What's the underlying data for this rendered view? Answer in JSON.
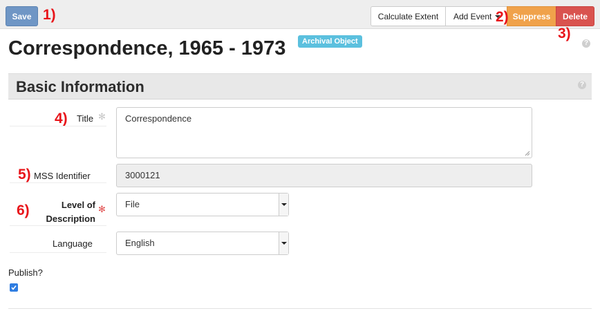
{
  "toolbar": {
    "save_label": "Save",
    "calculate_extent_label": "Calculate Extent",
    "add_event_label": "Add Event",
    "suppress_label": "Suppress",
    "delete_label": "Delete"
  },
  "annotations": [
    "1)",
    "2)",
    "3)",
    "4)",
    "5)",
    "6)"
  ],
  "header": {
    "title": "Correspondence, 1965 - 1973",
    "badge": "Archival Object"
  },
  "section": {
    "title": "Basic Information"
  },
  "form": {
    "title_label": "Title",
    "title_value": "Correspondence",
    "mss_label": "MSS Identifier",
    "mss_value": "3000121",
    "level_label_line1": "Level of",
    "level_label_line2": "Description",
    "level_value": "File",
    "language_label": "Language",
    "language_value": "English",
    "publish_label": "Publish?",
    "publish_checked": true
  },
  "colors": {
    "save": "#6f96c5",
    "suppress": "#f0a24b",
    "delete": "#d9534f",
    "badge": "#5bc0de",
    "annotation": "#e8141a"
  }
}
